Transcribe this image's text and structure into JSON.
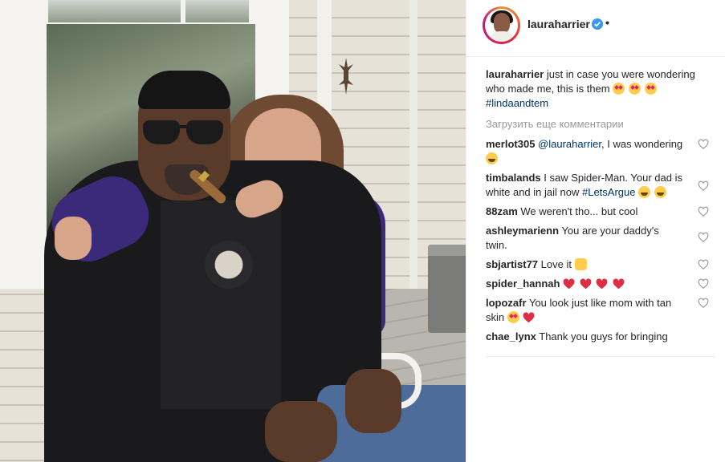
{
  "post": {
    "username": "laurah arrier",
    "username_clean": "lauraharrier",
    "dot": "•"
  },
  "caption": {
    "user": "lauraharrier",
    "text": "just in case you were wondering who made me, this is them",
    "hashtag": "#lindaandtem"
  },
  "load_more": "Загрузить еще комментарии",
  "comments": [
    {
      "user": "merlot305",
      "mention": "@lauraharrier",
      "text": ", I was wondering"
    },
    {
      "user": "timbalands",
      "text": "I saw Spider-Man. Your dad is white and in jail now",
      "hashtag": "#LetsArgue"
    },
    {
      "user": "88zam",
      "text": "We weren't tho... but cool"
    },
    {
      "user": "ashleymarienn",
      "text": "You are your daddy's twin."
    },
    {
      "user": "sbjartist77",
      "text": "Love it"
    },
    {
      "user": "spider_hannah",
      "text": ""
    },
    {
      "user": "lopozafr",
      "text": "You look just like mom with tan skin"
    },
    {
      "user": "chae_lynx",
      "text": "Thank you guys for bringing"
    }
  ],
  "colors": {
    "username": "#262626",
    "hashtag": "#003569",
    "muted": "#999999",
    "verified": "#3897f0"
  },
  "icons": {
    "verified": "verified-badge-icon",
    "like": "heart-outline-icon"
  }
}
